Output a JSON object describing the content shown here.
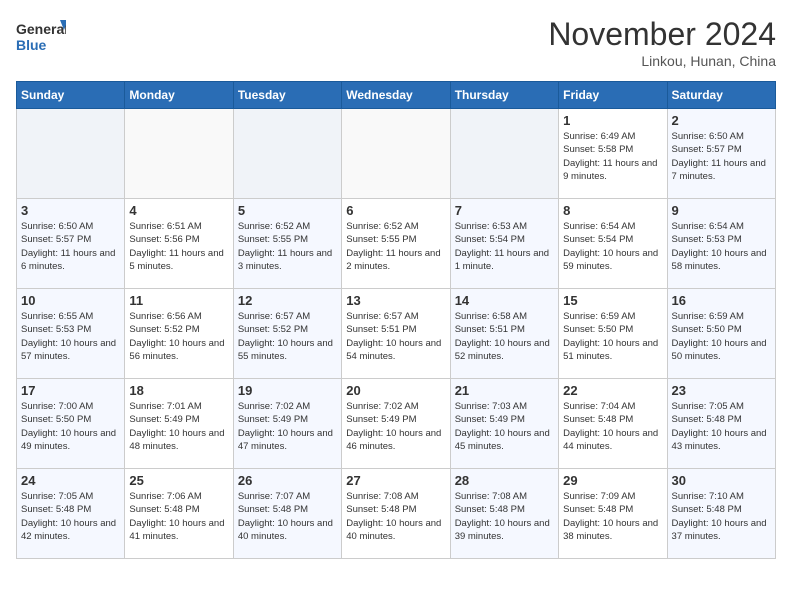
{
  "header": {
    "logo_line1": "General",
    "logo_line2": "Blue",
    "month": "November 2024",
    "location": "Linkou, Hunan, China"
  },
  "weekdays": [
    "Sunday",
    "Monday",
    "Tuesday",
    "Wednesday",
    "Thursday",
    "Friday",
    "Saturday"
  ],
  "weeks": [
    [
      {
        "day": "",
        "info": ""
      },
      {
        "day": "",
        "info": ""
      },
      {
        "day": "",
        "info": ""
      },
      {
        "day": "",
        "info": ""
      },
      {
        "day": "",
        "info": ""
      },
      {
        "day": "1",
        "info": "Sunrise: 6:49 AM\nSunset: 5:58 PM\nDaylight: 11 hours and 9 minutes."
      },
      {
        "day": "2",
        "info": "Sunrise: 6:50 AM\nSunset: 5:57 PM\nDaylight: 11 hours and 7 minutes."
      }
    ],
    [
      {
        "day": "3",
        "info": "Sunrise: 6:50 AM\nSunset: 5:57 PM\nDaylight: 11 hours and 6 minutes."
      },
      {
        "day": "4",
        "info": "Sunrise: 6:51 AM\nSunset: 5:56 PM\nDaylight: 11 hours and 5 minutes."
      },
      {
        "day": "5",
        "info": "Sunrise: 6:52 AM\nSunset: 5:55 PM\nDaylight: 11 hours and 3 minutes."
      },
      {
        "day": "6",
        "info": "Sunrise: 6:52 AM\nSunset: 5:55 PM\nDaylight: 11 hours and 2 minutes."
      },
      {
        "day": "7",
        "info": "Sunrise: 6:53 AM\nSunset: 5:54 PM\nDaylight: 11 hours and 1 minute."
      },
      {
        "day": "8",
        "info": "Sunrise: 6:54 AM\nSunset: 5:54 PM\nDaylight: 10 hours and 59 minutes."
      },
      {
        "day": "9",
        "info": "Sunrise: 6:54 AM\nSunset: 5:53 PM\nDaylight: 10 hours and 58 minutes."
      }
    ],
    [
      {
        "day": "10",
        "info": "Sunrise: 6:55 AM\nSunset: 5:53 PM\nDaylight: 10 hours and 57 minutes."
      },
      {
        "day": "11",
        "info": "Sunrise: 6:56 AM\nSunset: 5:52 PM\nDaylight: 10 hours and 56 minutes."
      },
      {
        "day": "12",
        "info": "Sunrise: 6:57 AM\nSunset: 5:52 PM\nDaylight: 10 hours and 55 minutes."
      },
      {
        "day": "13",
        "info": "Sunrise: 6:57 AM\nSunset: 5:51 PM\nDaylight: 10 hours and 54 minutes."
      },
      {
        "day": "14",
        "info": "Sunrise: 6:58 AM\nSunset: 5:51 PM\nDaylight: 10 hours and 52 minutes."
      },
      {
        "day": "15",
        "info": "Sunrise: 6:59 AM\nSunset: 5:50 PM\nDaylight: 10 hours and 51 minutes."
      },
      {
        "day": "16",
        "info": "Sunrise: 6:59 AM\nSunset: 5:50 PM\nDaylight: 10 hours and 50 minutes."
      }
    ],
    [
      {
        "day": "17",
        "info": "Sunrise: 7:00 AM\nSunset: 5:50 PM\nDaylight: 10 hours and 49 minutes."
      },
      {
        "day": "18",
        "info": "Sunrise: 7:01 AM\nSunset: 5:49 PM\nDaylight: 10 hours and 48 minutes."
      },
      {
        "day": "19",
        "info": "Sunrise: 7:02 AM\nSunset: 5:49 PM\nDaylight: 10 hours and 47 minutes."
      },
      {
        "day": "20",
        "info": "Sunrise: 7:02 AM\nSunset: 5:49 PM\nDaylight: 10 hours and 46 minutes."
      },
      {
        "day": "21",
        "info": "Sunrise: 7:03 AM\nSunset: 5:49 PM\nDaylight: 10 hours and 45 minutes."
      },
      {
        "day": "22",
        "info": "Sunrise: 7:04 AM\nSunset: 5:48 PM\nDaylight: 10 hours and 44 minutes."
      },
      {
        "day": "23",
        "info": "Sunrise: 7:05 AM\nSunset: 5:48 PM\nDaylight: 10 hours and 43 minutes."
      }
    ],
    [
      {
        "day": "24",
        "info": "Sunrise: 7:05 AM\nSunset: 5:48 PM\nDaylight: 10 hours and 42 minutes."
      },
      {
        "day": "25",
        "info": "Sunrise: 7:06 AM\nSunset: 5:48 PM\nDaylight: 10 hours and 41 minutes."
      },
      {
        "day": "26",
        "info": "Sunrise: 7:07 AM\nSunset: 5:48 PM\nDaylight: 10 hours and 40 minutes."
      },
      {
        "day": "27",
        "info": "Sunrise: 7:08 AM\nSunset: 5:48 PM\nDaylight: 10 hours and 40 minutes."
      },
      {
        "day": "28",
        "info": "Sunrise: 7:08 AM\nSunset: 5:48 PM\nDaylight: 10 hours and 39 minutes."
      },
      {
        "day": "29",
        "info": "Sunrise: 7:09 AM\nSunset: 5:48 PM\nDaylight: 10 hours and 38 minutes."
      },
      {
        "day": "30",
        "info": "Sunrise: 7:10 AM\nSunset: 5:48 PM\nDaylight: 10 hours and 37 minutes."
      }
    ]
  ]
}
